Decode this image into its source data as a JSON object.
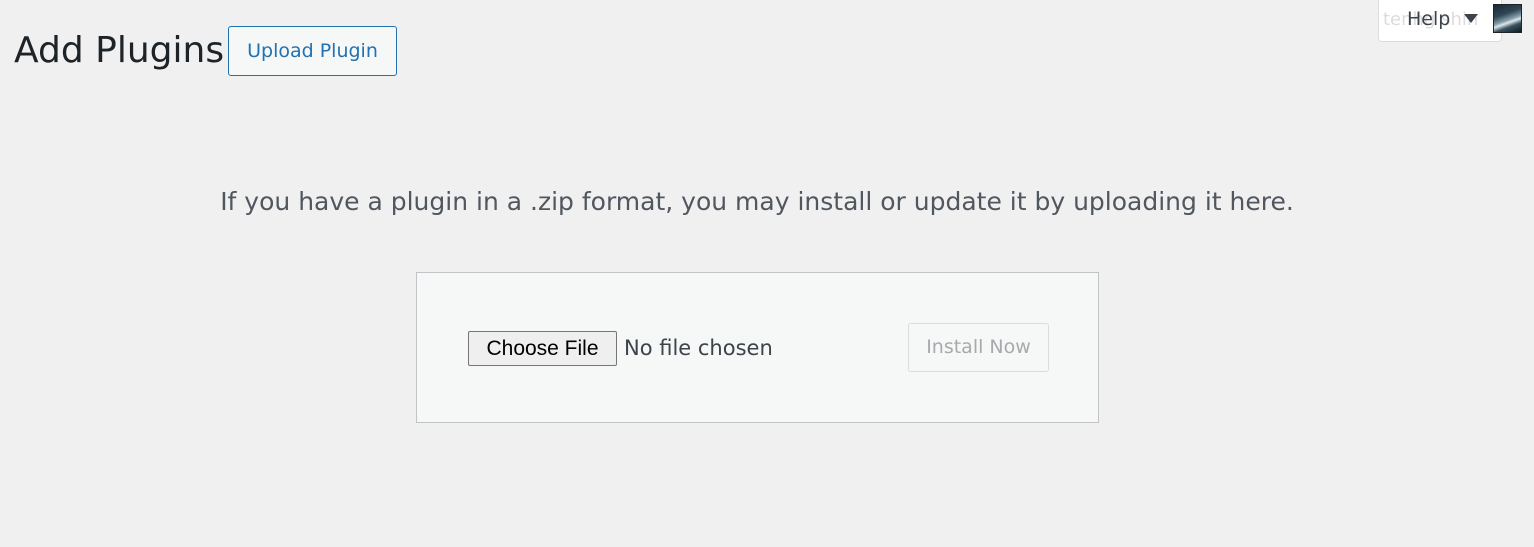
{
  "header": {
    "title": "Add Plugins",
    "upload_plugin_label": "Upload Plugin"
  },
  "screen_meta": {
    "help_label": "Help",
    "help_ghost_text": "tenhg shin",
    "help_icon": "caret-down-icon",
    "avatar_icon": "user-avatar"
  },
  "upload": {
    "description": "If you have a plugin in a .zip format, you may install or update it by uploading it here.",
    "choose_file_label": "Choose File",
    "file_status": "No file chosen",
    "install_now_label": "Install Now",
    "install_now_disabled": true
  },
  "colors": {
    "background": "#f0f0f1",
    "accent": "#2271b1",
    "disabled_text": "#a7aaad"
  }
}
